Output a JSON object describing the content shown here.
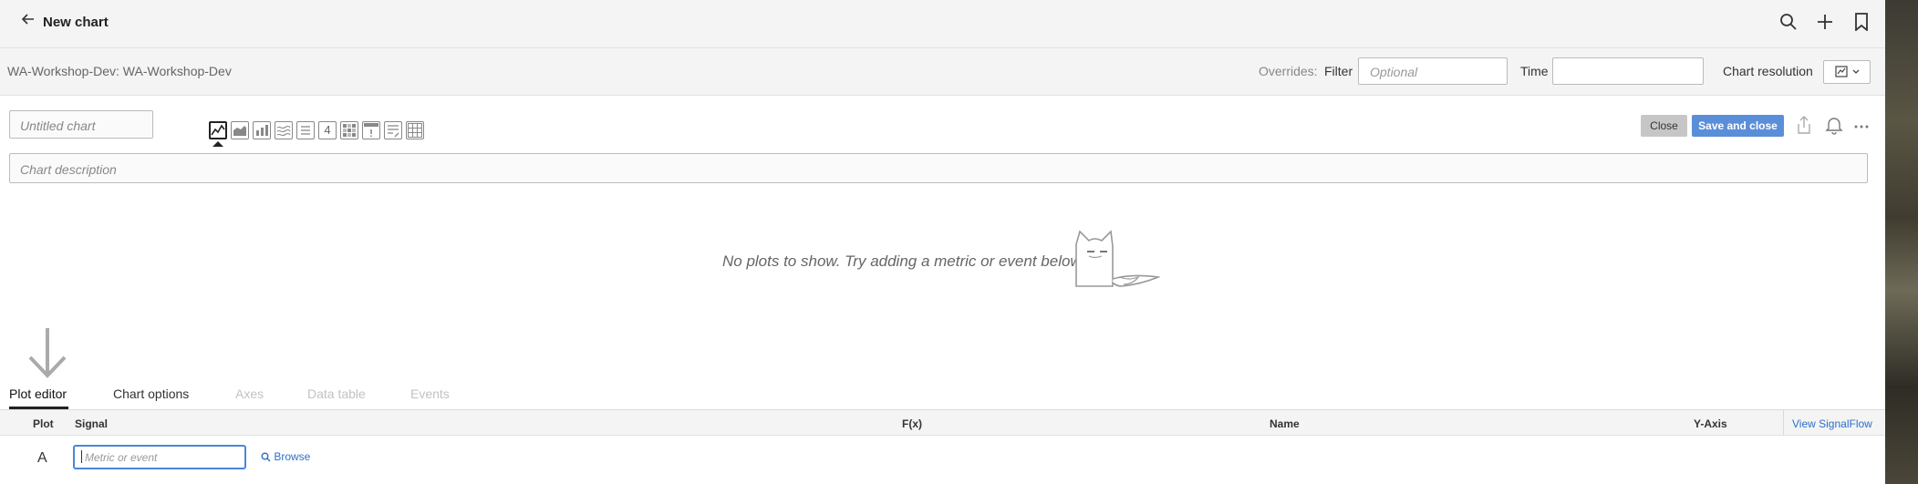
{
  "header": {
    "back_icon": "arrow-left-icon",
    "title": "New chart",
    "icons": [
      "search-icon",
      "plus-icon",
      "bookmark-icon"
    ]
  },
  "overrides": {
    "org": "WA-Workshop-Dev: WA-Workshop-Dev",
    "label": "Overrides:",
    "filter_label": "Filter",
    "filter_placeholder": "Optional",
    "time_label": "Time",
    "time_value": "",
    "resolution_label": "Chart resolution"
  },
  "chart": {
    "name_placeholder": "Untitled chart",
    "description_placeholder": "Chart description",
    "types": [
      "line-chart-icon",
      "area-chart-icon",
      "column-chart-icon",
      "histogram-icon",
      "list-icon",
      "single-value-icon",
      "heatmap-icon",
      "event-feed-icon",
      "text-icon",
      "table-icon"
    ],
    "single_value_glyph": "4",
    "selected_type": "line-chart-icon",
    "close_label": "Close",
    "save_label": "Save and close",
    "empty_message": "No plots to show. Try adding a metric or event below."
  },
  "tabs": [
    {
      "label": "Plot editor",
      "state": "active"
    },
    {
      "label": "Chart options",
      "state": "enabled"
    },
    {
      "label": "Axes",
      "state": "disabled"
    },
    {
      "label": "Data table",
      "state": "disabled"
    },
    {
      "label": "Events",
      "state": "disabled"
    }
  ],
  "plot_table": {
    "columns": [
      "Plot",
      "Signal",
      "F(x)",
      "Name",
      "Y-Axis"
    ],
    "view_signalflow": "View SignalFlow",
    "rows": [
      {
        "letter": "A",
        "signal_placeholder": "Metric or event",
        "browse": "Browse"
      }
    ]
  },
  "colors": {
    "primary": "#5b8ed9",
    "link": "#2c6fc9",
    "bar_bg": "#f4f4f4"
  }
}
